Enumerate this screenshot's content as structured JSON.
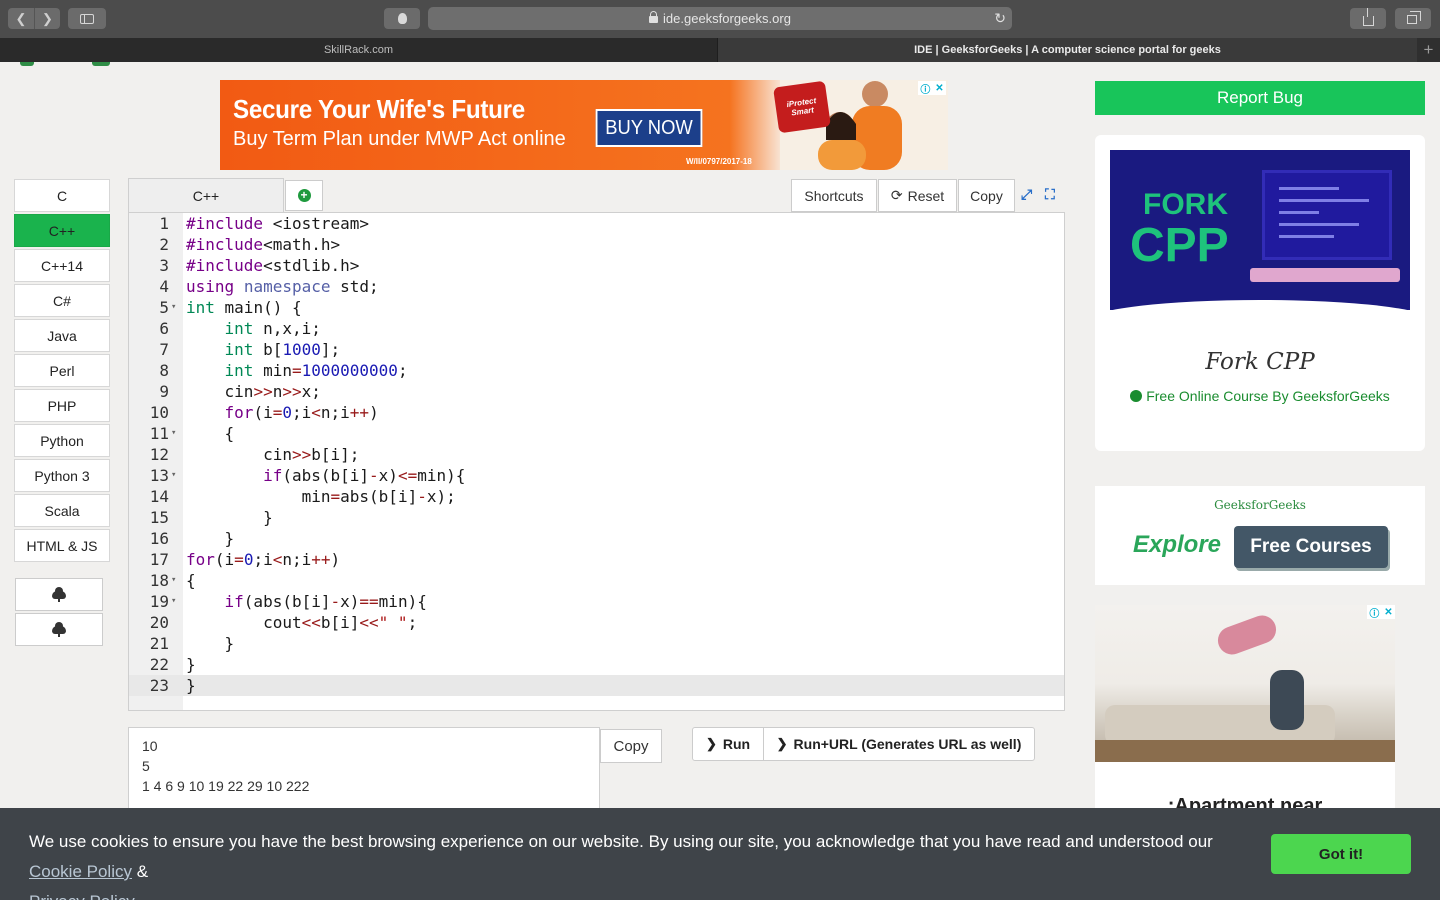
{
  "browser": {
    "url": "ide.geeksforgeeks.org",
    "tabs": [
      {
        "label": "SkillRack.com"
      },
      {
        "label": "IDE | GeeksforGeeks | A computer science portal for geeks"
      }
    ],
    "new_tab_label": "+"
  },
  "ad_banner": {
    "headline": "Secure Your Wife's Future",
    "subline": "Buy Term Plan under MWP Act online",
    "button": "BUY NOW",
    "code": "W/II/0797/2017-18",
    "badge_line1": "iProtect",
    "badge_line2": "Smart",
    "info_icon": "ⓘ",
    "close_icon": "✕"
  },
  "languages": [
    {
      "label": "C",
      "active": false
    },
    {
      "label": "C++",
      "active": true
    },
    {
      "label": "C++14",
      "active": false
    },
    {
      "label": "C#",
      "active": false
    },
    {
      "label": "Java",
      "active": false
    },
    {
      "label": "Perl",
      "active": false
    },
    {
      "label": "PHP",
      "active": false
    },
    {
      "label": "Python",
      "active": false
    },
    {
      "label": "Python 3",
      "active": false
    },
    {
      "label": "Scala",
      "active": false
    },
    {
      "label": "HTML & JS",
      "active": false
    }
  ],
  "cloud_buttons": [
    "cloud-download-icon",
    "cloud-upload-icon"
  ],
  "editor": {
    "tab_label": "C++",
    "add_tab_icon": "+",
    "shortcuts_label": "Shortcuts",
    "reset_label": "Reset",
    "copy_label": "Copy",
    "reset_icon": "⟳",
    "expand_icon": "⤢",
    "fullscreen_icon": "⛶",
    "current_line": 23,
    "lines": [
      {
        "n": "1",
        "fold": false,
        "code": "#include <iostream>"
      },
      {
        "n": "2",
        "fold": false,
        "code": "#include<math.h>"
      },
      {
        "n": "3",
        "fold": false,
        "code": "#include<stdlib.h>"
      },
      {
        "n": "4",
        "fold": false,
        "code": "using namespace std;"
      },
      {
        "n": "5",
        "fold": true,
        "code": "int main() {"
      },
      {
        "n": "6",
        "fold": false,
        "code": "    int n,x,i;"
      },
      {
        "n": "7",
        "fold": false,
        "code": "    int b[1000];"
      },
      {
        "n": "8",
        "fold": false,
        "code": "    int min=1000000000;"
      },
      {
        "n": "9",
        "fold": false,
        "code": "    cin>>n>>x;"
      },
      {
        "n": "10",
        "fold": false,
        "code": "    for(i=0;i<n;i++)"
      },
      {
        "n": "11",
        "fold": true,
        "code": "    {"
      },
      {
        "n": "12",
        "fold": false,
        "code": "        cin>>b[i];"
      },
      {
        "n": "13",
        "fold": true,
        "code": "        if(abs(b[i]-x)<=min){"
      },
      {
        "n": "14",
        "fold": false,
        "code": "            min=abs(b[i]-x);"
      },
      {
        "n": "15",
        "fold": false,
        "code": "        }"
      },
      {
        "n": "16",
        "fold": false,
        "code": "    }"
      },
      {
        "n": "17",
        "fold": false,
        "code": "for(i=0;i<n;i++)"
      },
      {
        "n": "18",
        "fold": true,
        "code": "{"
      },
      {
        "n": "19",
        "fold": true,
        "code": "    if(abs(b[i]-x)==min){"
      },
      {
        "n": "20",
        "fold": false,
        "code": "        cout<<b[i]<<\" \";"
      },
      {
        "n": "21",
        "fold": false,
        "code": "    }"
      },
      {
        "n": "22",
        "fold": false,
        "code": "}"
      },
      {
        "n": "23",
        "fold": false,
        "code": "}"
      }
    ]
  },
  "stdin": {
    "lines": [
      "10",
      "5",
      "1 4 6 9 10 19 22 29 10 222"
    ],
    "copy_label": "Copy"
  },
  "run": {
    "run_label": "Run",
    "run_url_label": "Run+URL (Generates URL as well)",
    "chevron": "❯"
  },
  "sidebar_right": {
    "report_bug": "Report Bug",
    "course": {
      "image_fork": "FORK",
      "image_cpp": "CPP",
      "title": "Fork CPP",
      "link": "Free Online Course By GeeksforGeeks"
    },
    "explore": {
      "brand": "GeeksforGeeks",
      "word": "Explore",
      "button": "Free Courses"
    },
    "photo_ad": {
      "caption": ":Apartment near",
      "info_icon": "ⓘ",
      "close_icon": "✕"
    }
  },
  "cookie": {
    "text": "We use cookies to ensure you have the best browsing experience on our website. By using our site, you acknowledge that you have read and understood our ",
    "cookie_policy": "Cookie Policy",
    "amp": " & ",
    "privacy_policy": "Privacy Policy",
    "button": "Got it!"
  },
  "colors": {
    "gfg_green": "#18c55a",
    "active_lang": "#1ab34d",
    "cookie_bg": "#3f4449",
    "got_it": "#4cd64f"
  }
}
